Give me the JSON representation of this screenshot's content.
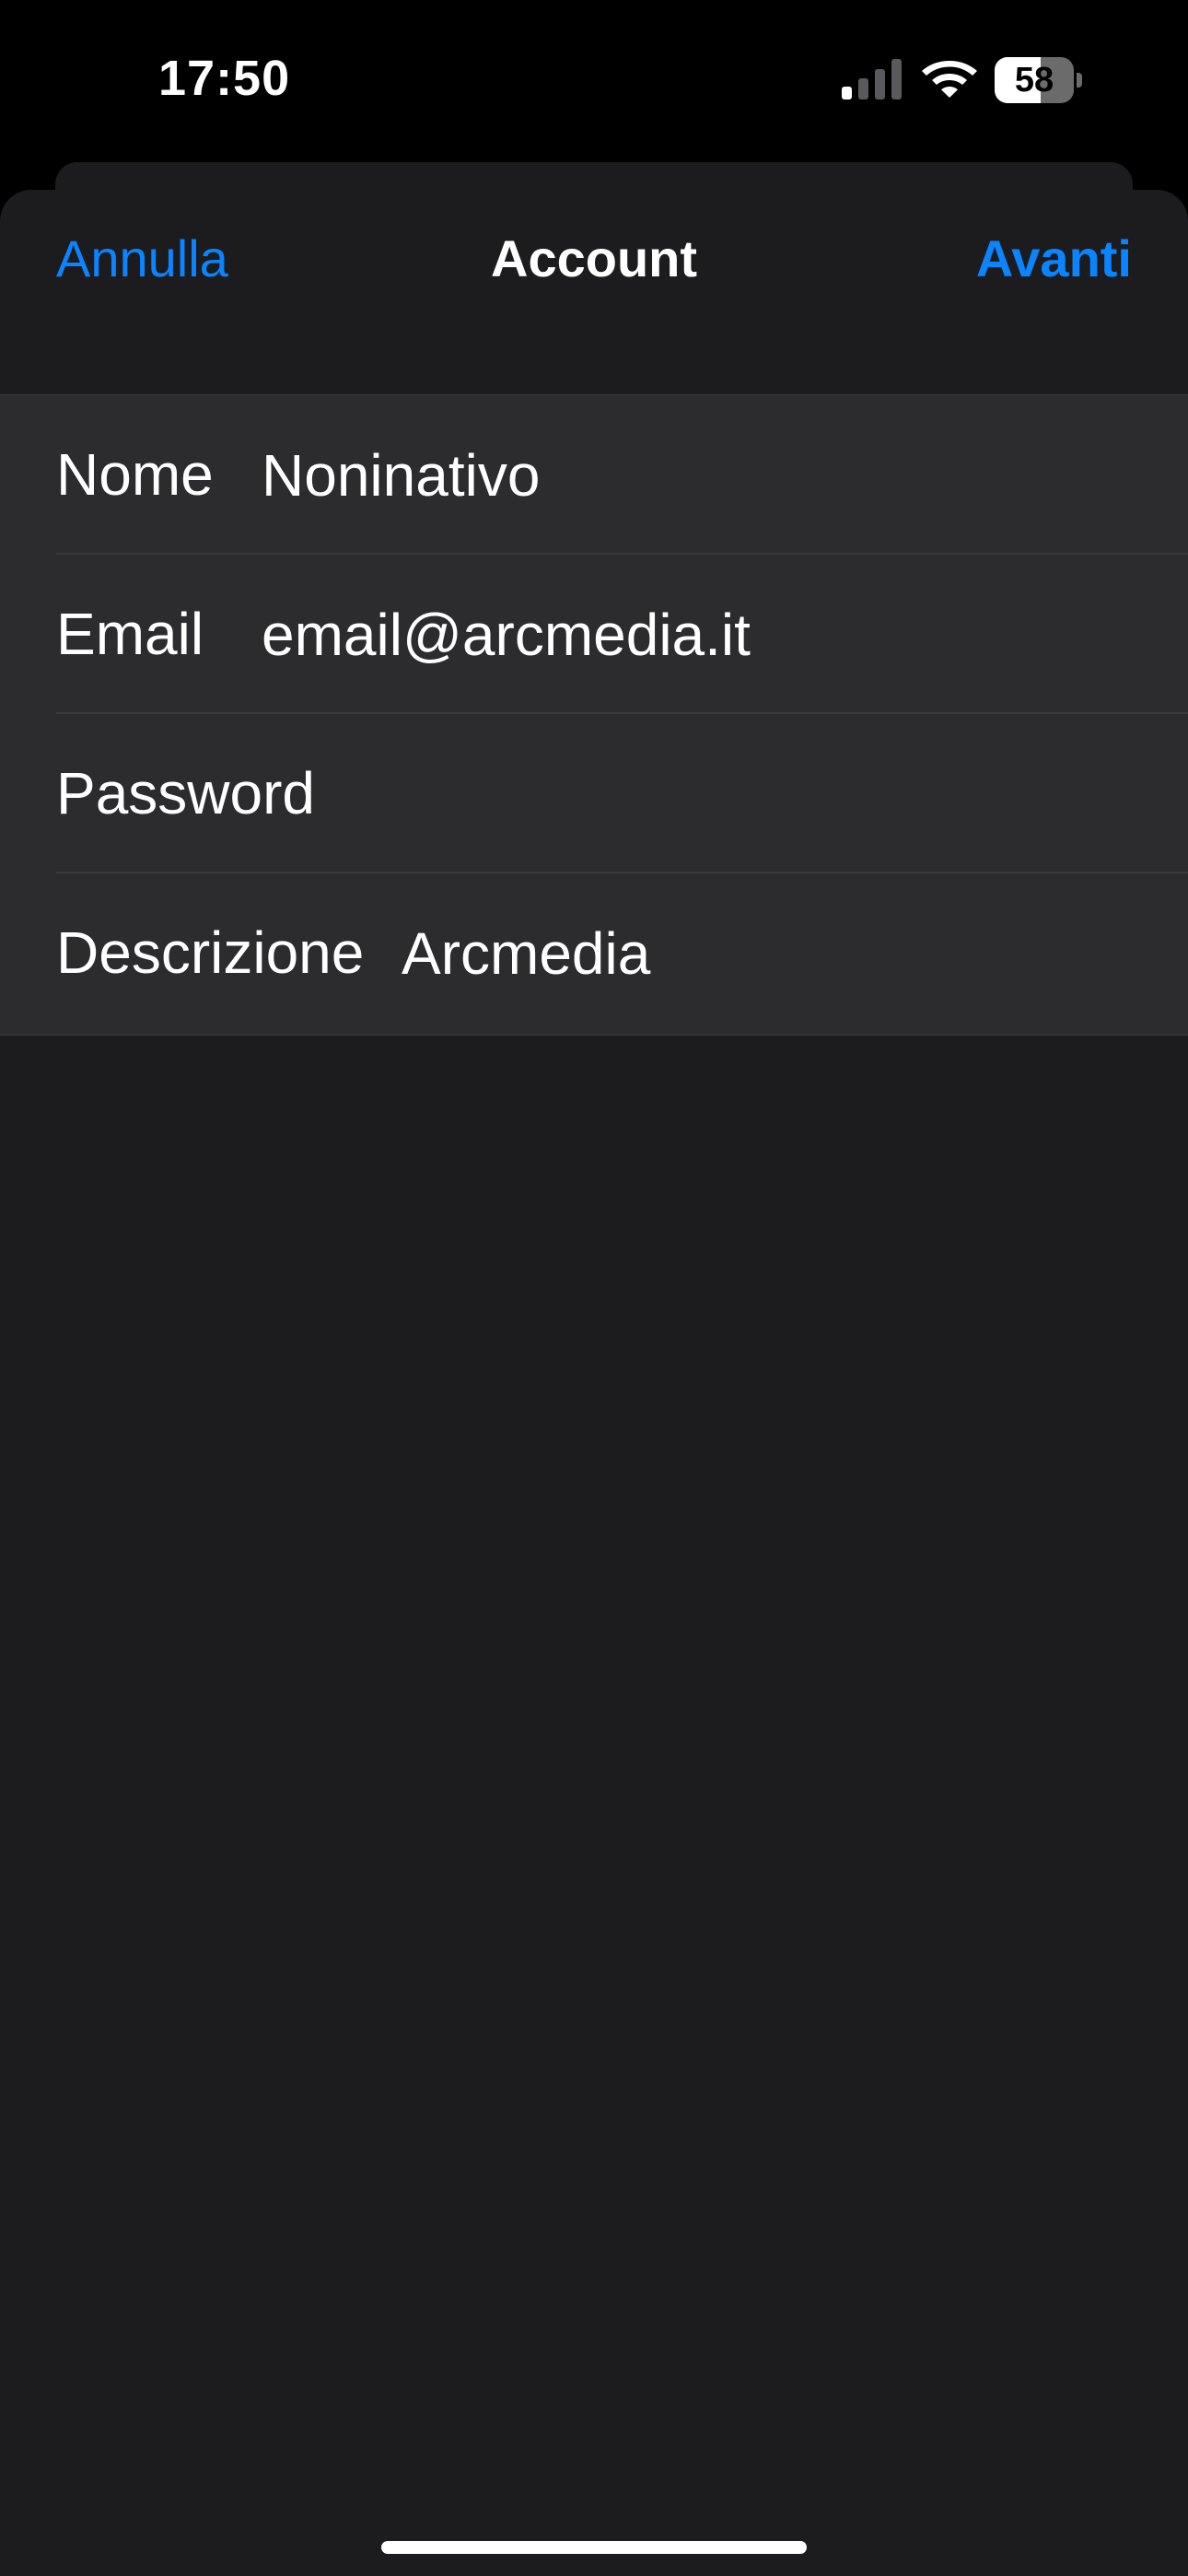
{
  "status_bar": {
    "time": "17:50",
    "battery_percent": 58,
    "battery_label": "58",
    "signal_bars_active": 1,
    "signal_bars_total": 4,
    "icons": [
      "signal-icon",
      "wifi-icon",
      "battery-icon"
    ]
  },
  "nav": {
    "cancel_label": "Annulla",
    "title": "Account",
    "next_label": "Avanti"
  },
  "form": {
    "fields": [
      {
        "label": "Nome",
        "value": "Noninativo",
        "placeholder": ""
      },
      {
        "label": "Email",
        "value": "email@arcmedia.it",
        "placeholder": ""
      },
      {
        "label": "Password",
        "value": "",
        "placeholder": ""
      },
      {
        "label": "Descrizione",
        "value": "Arcmedia",
        "placeholder": ""
      }
    ]
  },
  "colors": {
    "accent": "#0a84ff",
    "background": "#000000",
    "sheet": "#1c1c1e",
    "group": "#2c2c2e",
    "separator": "#3a3a3c",
    "text": "#ffffff"
  }
}
